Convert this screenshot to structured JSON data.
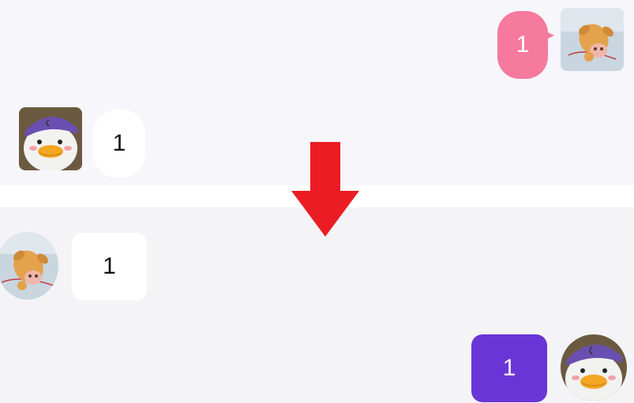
{
  "top_chat": {
    "outgoing_message": "1",
    "incoming_message": "1",
    "outgoing_bubble_color": "#f57a9e",
    "incoming_bubble_color": "#ffffff",
    "outgoing_avatar_icon": "puppy-avatar-icon",
    "incoming_avatar_icon": "duck-avatar-icon"
  },
  "bottom_chat": {
    "incoming_message": "1",
    "outgoing_message": "1",
    "incoming_bubble_color": "#ffffff",
    "outgoing_bubble_color": "#6a35d6",
    "incoming_avatar_icon": "puppy-avatar-icon",
    "outgoing_avatar_icon": "duck-avatar-icon"
  },
  "transition_arrow": {
    "icon": "down-arrow-icon",
    "color": "#ec1c24"
  }
}
